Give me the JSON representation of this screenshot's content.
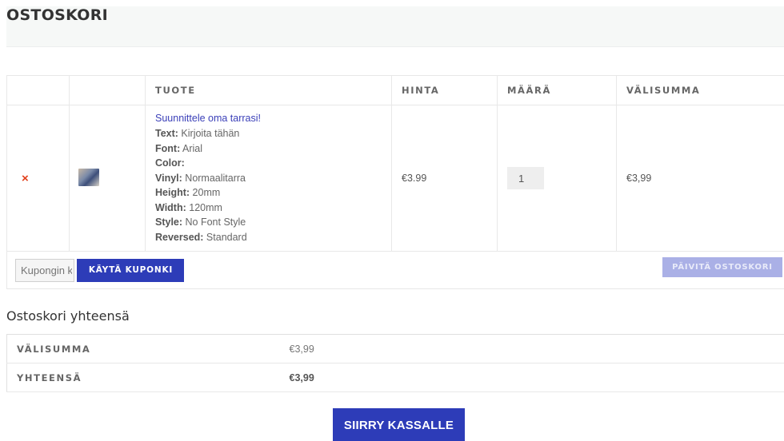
{
  "page": {
    "title": "OSTOSKORI"
  },
  "cart": {
    "headers": {
      "remove": "",
      "thumbnail": "",
      "product": "TUOTE",
      "price": "HINTA",
      "quantity": "MÄÄRÄ",
      "subtotal": "VÄLISUMMA"
    },
    "item": {
      "remove_icon": "×",
      "thumbnail_icon": "product-thumbnail-image",
      "name": "Suunnittele oma tarrasi!",
      "attributes": [
        {
          "key": "Text:",
          "value": " Kirjoita tähän"
        },
        {
          "key": "Font:",
          "value": " Arial"
        },
        {
          "key": "Color:",
          "value": ""
        },
        {
          "key": "Vinyl:",
          "value": " Normaalitarra"
        },
        {
          "key": "Height:",
          "value": " 20mm"
        },
        {
          "key": "Width:",
          "value": " 120mm"
        },
        {
          "key": "Style:",
          "value": " No Font Style"
        },
        {
          "key": "Reversed:",
          "value": " Standard"
        }
      ],
      "price": "€3.99",
      "quantity": "1",
      "subtotal": "€3,99"
    },
    "actions": {
      "coupon_placeholder": "Kupongin koodi",
      "apply_coupon": "KÄYTÄ KUPONKI",
      "update_cart": "PÄIVITÄ OSTOSKORI"
    }
  },
  "totals": {
    "title": "Ostoskori yhteensä",
    "rows": [
      {
        "label": "VÄLISUMMA",
        "value": "€3,99"
      },
      {
        "label": "YHTEENSÄ",
        "value": "€3,99"
      }
    ],
    "checkout": "SIIRRY KASSALLE"
  },
  "colors": {
    "accent": "#2d3cb8",
    "link": "#3a3fb8",
    "remove": "#e2401c",
    "disabled_button": "#aab0e6"
  }
}
